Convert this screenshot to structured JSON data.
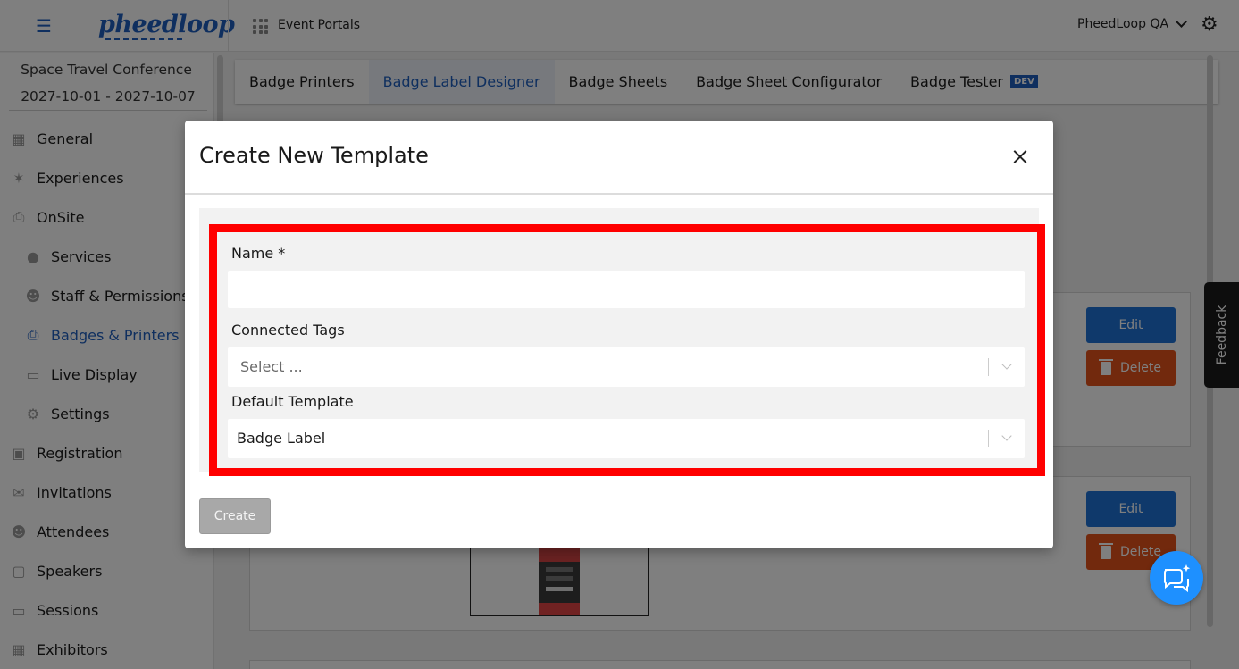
{
  "topbar": {
    "logo_text": "pheedloop",
    "event_portals_label": "Event Portals",
    "org_name": "PheedLoop QA"
  },
  "sidebar": {
    "event_name": "Space Travel Conference",
    "event_dates": "2027-10-01 - 2027-10-07",
    "items": [
      {
        "label": "General",
        "icon": "grid-icon"
      },
      {
        "label": "Experiences",
        "icon": "person-icon"
      },
      {
        "label": "OnSite",
        "icon": "printer-icon"
      },
      {
        "label": "Services",
        "icon": "globe-icon"
      },
      {
        "label": "Staff & Permissions",
        "icon": "people-icon"
      },
      {
        "label": "Badges & Printers",
        "icon": "printer-icon"
      },
      {
        "label": "Live Display",
        "icon": "monitor-icon"
      },
      {
        "label": "Settings",
        "icon": "gear-icon"
      },
      {
        "label": "Registration",
        "icon": "cart-icon"
      },
      {
        "label": "Invitations",
        "icon": "mail-icon"
      },
      {
        "label": "Attendees",
        "icon": "people-icon"
      },
      {
        "label": "Speakers",
        "icon": "podium-icon"
      },
      {
        "label": "Sessions",
        "icon": "laptop-icon"
      },
      {
        "label": "Exhibitors",
        "icon": "store-icon"
      }
    ]
  },
  "tabs": [
    {
      "label": "Badge Printers"
    },
    {
      "label": "Badge Label Designer"
    },
    {
      "label": "Badge Sheets"
    },
    {
      "label": "Badge Sheet Configurator"
    },
    {
      "label": "Badge Tester"
    }
  ],
  "dev_badge": "DEV",
  "cards": {
    "edit_label": "Edit",
    "delete_label": "Delete"
  },
  "feedback_label": "Feedback",
  "modal": {
    "title": "Create New Template",
    "name_label": "Name *",
    "name_value": "",
    "tags_label": "Connected Tags",
    "tags_placeholder": "Select ...",
    "default_template_label": "Default Template",
    "default_template_value": "Badge Label",
    "create_label": "Create"
  },
  "colors": {
    "brand_blue": "#1f5fbf",
    "edit_button": "#1f72d6",
    "delete_button": "#e5531a",
    "highlight_red": "#ff0000",
    "chat_button": "#1e90ff"
  }
}
